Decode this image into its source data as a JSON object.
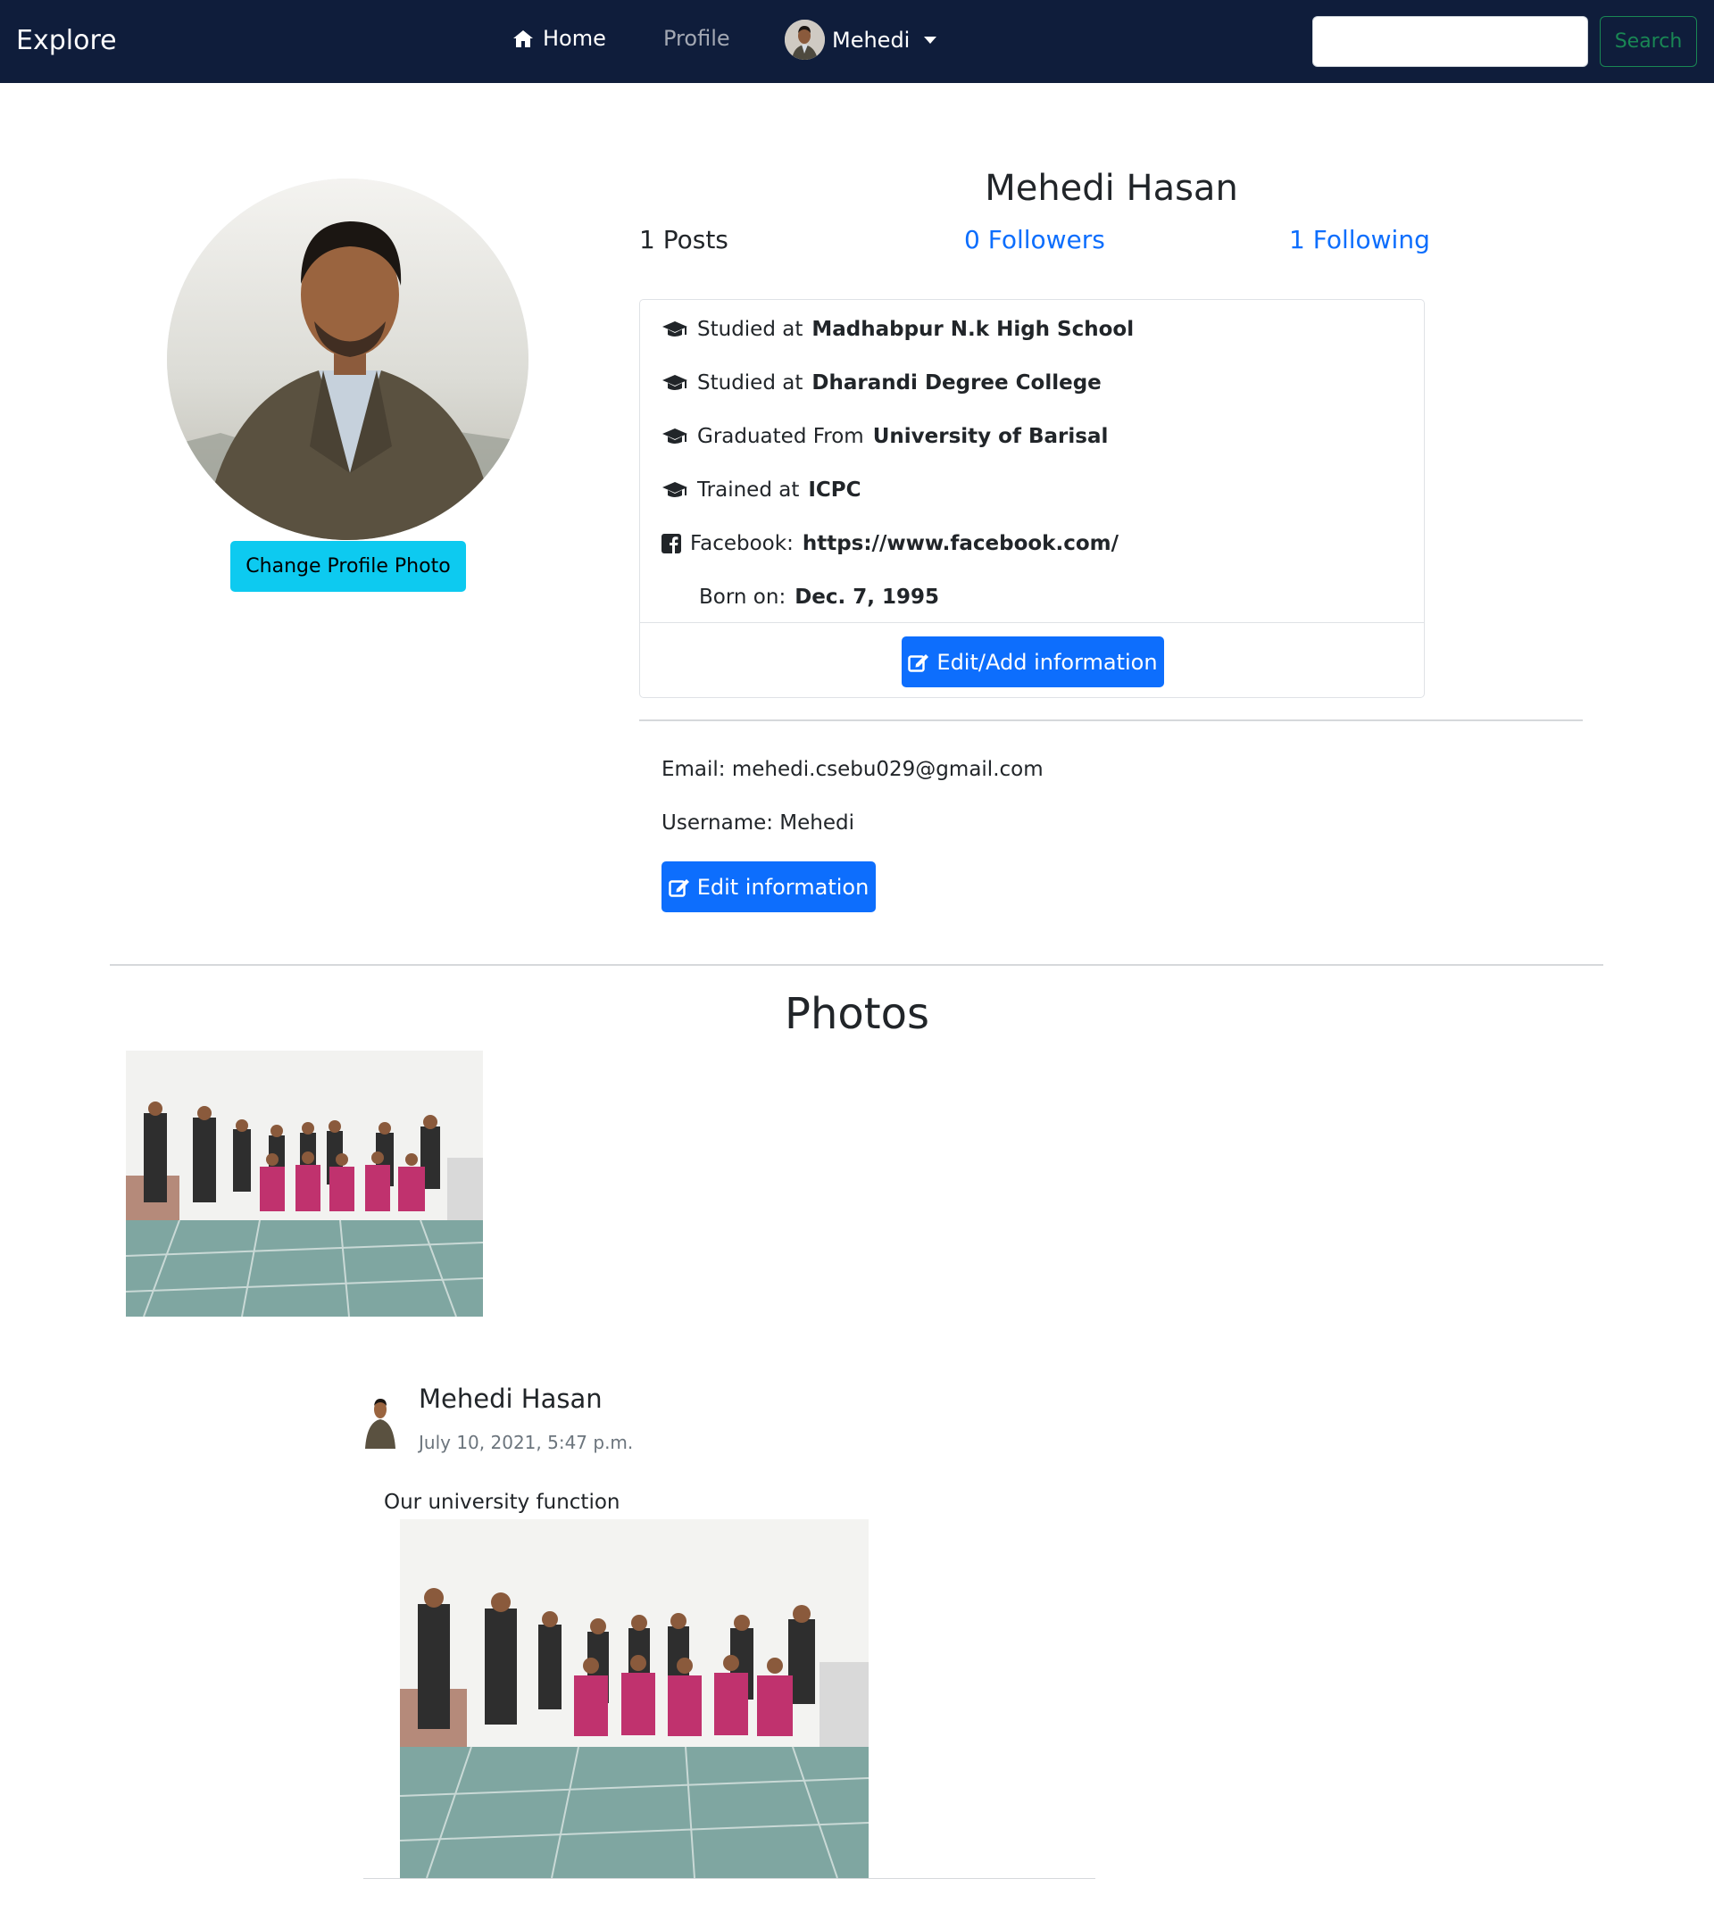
{
  "navbar": {
    "brand": "Explore",
    "home_label": "Home",
    "profile_label": "Profile",
    "user_label": "Mehedi",
    "search_placeholder": "",
    "search_button": "Search"
  },
  "profile": {
    "change_photo_label": "Change Profile Photo",
    "name": "Mehedi Hasan",
    "posts_stat": "1 Posts",
    "followers_stat": "0 Followers",
    "following_stat": "1 Following"
  },
  "info": {
    "items": [
      {
        "icon": "graduation-cap-icon",
        "prefix": "Studied at",
        "value": "Madhabpur N.k High School"
      },
      {
        "icon": "graduation-cap-icon",
        "prefix": "Studied at",
        "value": "Dharandi Degree College"
      },
      {
        "icon": "graduation-cap-icon",
        "prefix": "Graduated From",
        "value": "University of Barisal"
      },
      {
        "icon": "graduation-cap-icon",
        "prefix": "Trained at",
        "value": "ICPC"
      },
      {
        "icon": "facebook-icon",
        "prefix": "Facebook:",
        "value": "https://www.facebook.com/"
      },
      {
        "icon": "",
        "prefix": "Born on:",
        "value": "Dec. 7, 1995"
      }
    ],
    "edit_add_label": "Edit/Add information"
  },
  "account": {
    "email_line": "Email: mehedi.csebu029@gmail.com",
    "username_line": "Username: Mehedi",
    "edit_label": "Edit information"
  },
  "photos": {
    "heading": "Photos"
  },
  "post": {
    "author": "Mehedi Hasan",
    "date": "July 10, 2021, 5:47 p.m.",
    "text": "Our university function"
  },
  "colors": {
    "navbar_bg": "#0f1d3b",
    "primary": "#0d6efd",
    "info": "#0dcaf0",
    "success": "#198754"
  }
}
